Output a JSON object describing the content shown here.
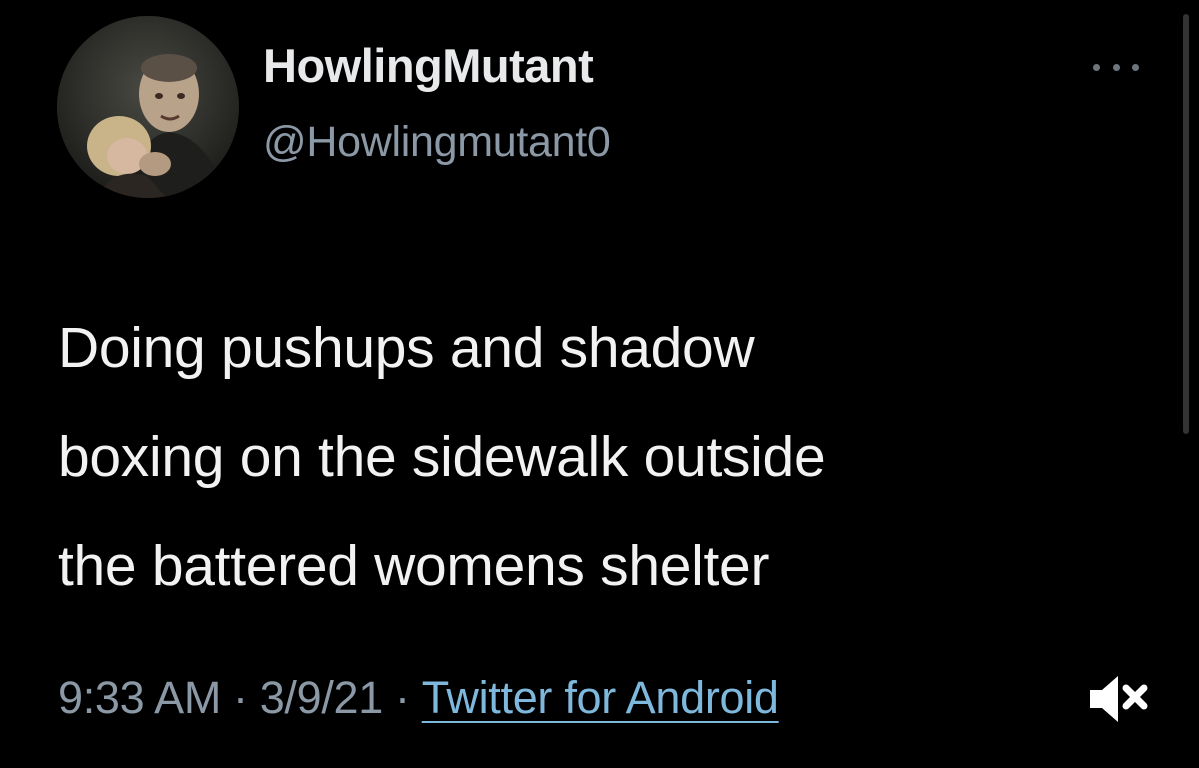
{
  "tweet": {
    "display_name": "HowlingMutant",
    "handle": "@Howlingmutant0",
    "text_lines": [
      "Doing pushups and shadow",
      "boxing on the sidewalk outside",
      "the battered womens shelter"
    ],
    "time": "9:33 AM",
    "separator": "·",
    "date": "3/9/21",
    "source": "Twitter for Android"
  },
  "icons": {
    "more": "more-options-icon",
    "mute": "volume-muted-icon",
    "avatar": "profile-avatar"
  },
  "colors": {
    "background": "#000000",
    "text_primary": "#e7e9ea",
    "text_secondary": "#8b98a5",
    "link": "#7eb8dc"
  }
}
